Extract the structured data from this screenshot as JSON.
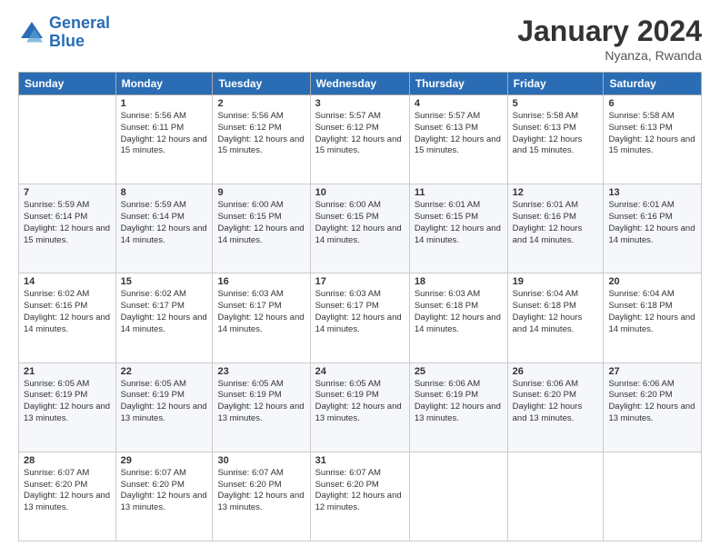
{
  "header": {
    "logo": {
      "line1": "General",
      "line2": "Blue"
    },
    "title": "January 2024",
    "subtitle": "Nyanza, Rwanda"
  },
  "weekdays": [
    "Sunday",
    "Monday",
    "Tuesday",
    "Wednesday",
    "Thursday",
    "Friday",
    "Saturday"
  ],
  "weeks": [
    [
      {
        "day": "",
        "sunrise": "",
        "sunset": "",
        "daylight": ""
      },
      {
        "day": "1",
        "sunrise": "Sunrise: 5:56 AM",
        "sunset": "Sunset: 6:11 PM",
        "daylight": "Daylight: 12 hours and 15 minutes."
      },
      {
        "day": "2",
        "sunrise": "Sunrise: 5:56 AM",
        "sunset": "Sunset: 6:12 PM",
        "daylight": "Daylight: 12 hours and 15 minutes."
      },
      {
        "day": "3",
        "sunrise": "Sunrise: 5:57 AM",
        "sunset": "Sunset: 6:12 PM",
        "daylight": "Daylight: 12 hours and 15 minutes."
      },
      {
        "day": "4",
        "sunrise": "Sunrise: 5:57 AM",
        "sunset": "Sunset: 6:13 PM",
        "daylight": "Daylight: 12 hours and 15 minutes."
      },
      {
        "day": "5",
        "sunrise": "Sunrise: 5:58 AM",
        "sunset": "Sunset: 6:13 PM",
        "daylight": "Daylight: 12 hours and 15 minutes."
      },
      {
        "day": "6",
        "sunrise": "Sunrise: 5:58 AM",
        "sunset": "Sunset: 6:13 PM",
        "daylight": "Daylight: 12 hours and 15 minutes."
      }
    ],
    [
      {
        "day": "7",
        "sunrise": "Sunrise: 5:59 AM",
        "sunset": "Sunset: 6:14 PM",
        "daylight": "Daylight: 12 hours and 15 minutes."
      },
      {
        "day": "8",
        "sunrise": "Sunrise: 5:59 AM",
        "sunset": "Sunset: 6:14 PM",
        "daylight": "Daylight: 12 hours and 14 minutes."
      },
      {
        "day": "9",
        "sunrise": "Sunrise: 6:00 AM",
        "sunset": "Sunset: 6:15 PM",
        "daylight": "Daylight: 12 hours and 14 minutes."
      },
      {
        "day": "10",
        "sunrise": "Sunrise: 6:00 AM",
        "sunset": "Sunset: 6:15 PM",
        "daylight": "Daylight: 12 hours and 14 minutes."
      },
      {
        "day": "11",
        "sunrise": "Sunrise: 6:01 AM",
        "sunset": "Sunset: 6:15 PM",
        "daylight": "Daylight: 12 hours and 14 minutes."
      },
      {
        "day": "12",
        "sunrise": "Sunrise: 6:01 AM",
        "sunset": "Sunset: 6:16 PM",
        "daylight": "Daylight: 12 hours and 14 minutes."
      },
      {
        "day": "13",
        "sunrise": "Sunrise: 6:01 AM",
        "sunset": "Sunset: 6:16 PM",
        "daylight": "Daylight: 12 hours and 14 minutes."
      }
    ],
    [
      {
        "day": "14",
        "sunrise": "Sunrise: 6:02 AM",
        "sunset": "Sunset: 6:16 PM",
        "daylight": "Daylight: 12 hours and 14 minutes."
      },
      {
        "day": "15",
        "sunrise": "Sunrise: 6:02 AM",
        "sunset": "Sunset: 6:17 PM",
        "daylight": "Daylight: 12 hours and 14 minutes."
      },
      {
        "day": "16",
        "sunrise": "Sunrise: 6:03 AM",
        "sunset": "Sunset: 6:17 PM",
        "daylight": "Daylight: 12 hours and 14 minutes."
      },
      {
        "day": "17",
        "sunrise": "Sunrise: 6:03 AM",
        "sunset": "Sunset: 6:17 PM",
        "daylight": "Daylight: 12 hours and 14 minutes."
      },
      {
        "day": "18",
        "sunrise": "Sunrise: 6:03 AM",
        "sunset": "Sunset: 6:18 PM",
        "daylight": "Daylight: 12 hours and 14 minutes."
      },
      {
        "day": "19",
        "sunrise": "Sunrise: 6:04 AM",
        "sunset": "Sunset: 6:18 PM",
        "daylight": "Daylight: 12 hours and 14 minutes."
      },
      {
        "day": "20",
        "sunrise": "Sunrise: 6:04 AM",
        "sunset": "Sunset: 6:18 PM",
        "daylight": "Daylight: 12 hours and 14 minutes."
      }
    ],
    [
      {
        "day": "21",
        "sunrise": "Sunrise: 6:05 AM",
        "sunset": "Sunset: 6:19 PM",
        "daylight": "Daylight: 12 hours and 13 minutes."
      },
      {
        "day": "22",
        "sunrise": "Sunrise: 6:05 AM",
        "sunset": "Sunset: 6:19 PM",
        "daylight": "Daylight: 12 hours and 13 minutes."
      },
      {
        "day": "23",
        "sunrise": "Sunrise: 6:05 AM",
        "sunset": "Sunset: 6:19 PM",
        "daylight": "Daylight: 12 hours and 13 minutes."
      },
      {
        "day": "24",
        "sunrise": "Sunrise: 6:05 AM",
        "sunset": "Sunset: 6:19 PM",
        "daylight": "Daylight: 12 hours and 13 minutes."
      },
      {
        "day": "25",
        "sunrise": "Sunrise: 6:06 AM",
        "sunset": "Sunset: 6:19 PM",
        "daylight": "Daylight: 12 hours and 13 minutes."
      },
      {
        "day": "26",
        "sunrise": "Sunrise: 6:06 AM",
        "sunset": "Sunset: 6:20 PM",
        "daylight": "Daylight: 12 hours and 13 minutes."
      },
      {
        "day": "27",
        "sunrise": "Sunrise: 6:06 AM",
        "sunset": "Sunset: 6:20 PM",
        "daylight": "Daylight: 12 hours and 13 minutes."
      }
    ],
    [
      {
        "day": "28",
        "sunrise": "Sunrise: 6:07 AM",
        "sunset": "Sunset: 6:20 PM",
        "daylight": "Daylight: 12 hours and 13 minutes."
      },
      {
        "day": "29",
        "sunrise": "Sunrise: 6:07 AM",
        "sunset": "Sunset: 6:20 PM",
        "daylight": "Daylight: 12 hours and 13 minutes."
      },
      {
        "day": "30",
        "sunrise": "Sunrise: 6:07 AM",
        "sunset": "Sunset: 6:20 PM",
        "daylight": "Daylight: 12 hours and 13 minutes."
      },
      {
        "day": "31",
        "sunrise": "Sunrise: 6:07 AM",
        "sunset": "Sunset: 6:20 PM",
        "daylight": "Daylight: 12 hours and 12 minutes."
      },
      {
        "day": "",
        "sunrise": "",
        "sunset": "",
        "daylight": ""
      },
      {
        "day": "",
        "sunrise": "",
        "sunset": "",
        "daylight": ""
      },
      {
        "day": "",
        "sunrise": "",
        "sunset": "",
        "daylight": ""
      }
    ]
  ]
}
